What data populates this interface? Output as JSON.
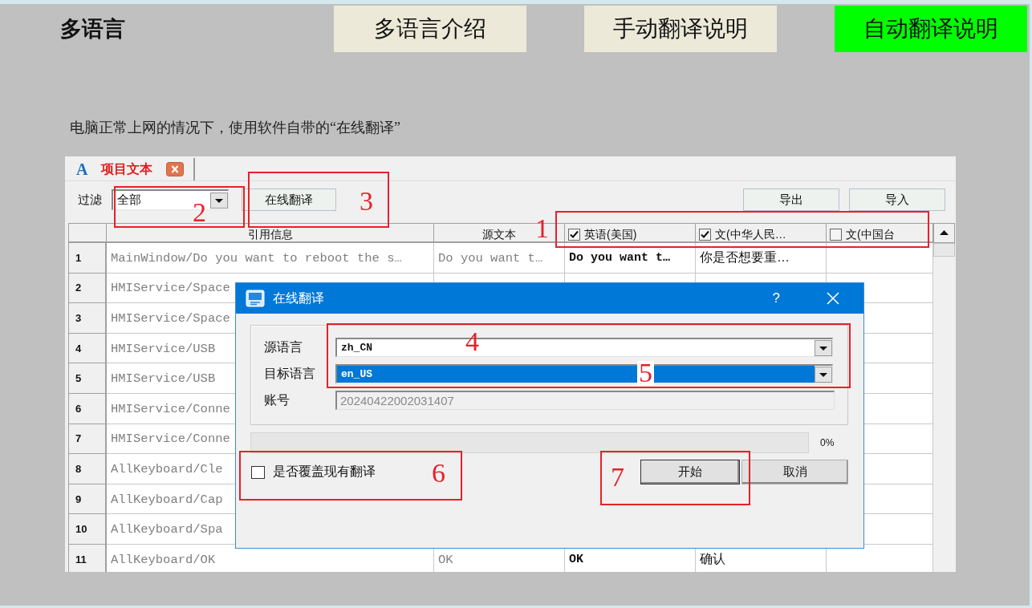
{
  "title": "多语言",
  "tabs": [
    {
      "label": "多语言介绍",
      "selected": false
    },
    {
      "label": "手动翻译说明",
      "selected": false
    },
    {
      "label": "自动翻译说明",
      "selected": true
    }
  ],
  "caption": "电脑正常上网的情况下，使用软件自带的“在线翻译”",
  "screenshot": {
    "tab": {
      "icon": "A",
      "label": "项目文本"
    },
    "filter": {
      "label": "过滤",
      "value": "全部"
    },
    "online_button": "在线翻译",
    "io_buttons": [
      "导出",
      "导入"
    ],
    "table": {
      "columns": [
        {
          "kind": "text",
          "label": "引用信息"
        },
        {
          "kind": "text",
          "label": "源文本"
        },
        {
          "kind": "language",
          "label": "英语(美国)",
          "checked": true
        },
        {
          "kind": "language",
          "label": "文(中华人民…",
          "checked": true
        },
        {
          "kind": "language",
          "label": "文(中国台",
          "checked": false
        }
      ],
      "rows": [
        {
          "number": "1",
          "cells": [
            "MainWindow/Do you want to reboot the s…",
            "Do you want t…",
            "Do you want t…",
            "你是否想要重…"
          ]
        },
        {
          "number": "2",
          "cells": [
            "HMIService/Space"
          ]
        },
        {
          "number": "3",
          "cells": [
            "HMIService/Space"
          ]
        },
        {
          "number": "4",
          "cells": [
            "HMIService/USB"
          ]
        },
        {
          "number": "5",
          "cells": [
            "HMIService/USB"
          ]
        },
        {
          "number": "6",
          "cells": [
            "HMIService/Conne"
          ]
        },
        {
          "number": "7",
          "cells": [
            "HMIService/Conne"
          ]
        },
        {
          "number": "8",
          "cells": [
            "AllKeyboard/Cle"
          ]
        },
        {
          "number": "9",
          "cells": [
            "AllKeyboard/Cap"
          ]
        },
        {
          "number": "10",
          "cells": [
            "AllKeyboard/Spa"
          ]
        },
        {
          "number": "11",
          "cells": [
            "AllKeyboard/OK",
            "OK",
            "OK",
            "确认"
          ]
        }
      ]
    },
    "dialog": {
      "title": "在线翻译",
      "help": "?",
      "fields": [
        {
          "kind": "combo",
          "label": "源语言",
          "value": "zh_CN",
          "focused": false
        },
        {
          "kind": "combo",
          "label": "目标语言",
          "value": "en_US",
          "focused": true
        },
        {
          "kind": "text",
          "label": "账号",
          "value": "20240422002031407",
          "disabled": true
        }
      ],
      "progress": {
        "level": 0,
        "reading": "0%"
      },
      "overwrite": {
        "label": "是否覆盖现有翻译",
        "checked": false
      },
      "buttons": [
        {
          "label": "开始",
          "default": true
        },
        {
          "label": "取消",
          "default": false
        }
      ]
    },
    "annotations": [
      {
        "number": "1",
        "framed": true
      },
      {
        "number": "2",
        "framed": true
      },
      {
        "number": "3",
        "framed": true
      },
      {
        "number": "4",
        "framed": true
      },
      {
        "number": "5",
        "framed": false
      },
      {
        "number": "6",
        "framed": true
      },
      {
        "number": "7",
        "framed": true
      }
    ]
  }
}
